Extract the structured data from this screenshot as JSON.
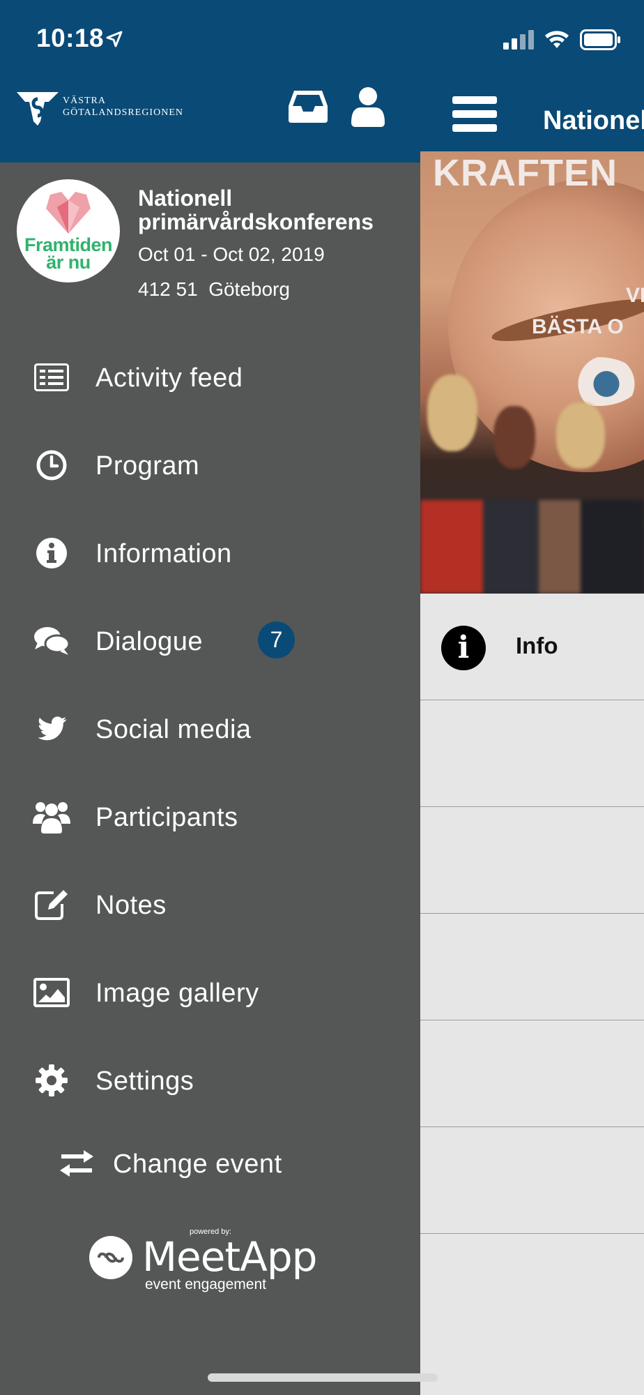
{
  "status_bar": {
    "time": "10:18"
  },
  "drawer": {
    "org_logo_text": "VÄSTRA\nGÖTALANDSREGIONEN",
    "event": {
      "logo_text": "Framtiden\när nu",
      "title": "Nationell primärvårdskonferens",
      "dates": "Oct 01 - Oct 02, 2019",
      "location": "412 51  Göteborg"
    },
    "menu": [
      {
        "label": "Activity feed",
        "icon": "activity-feed-icon"
      },
      {
        "label": "Program",
        "icon": "clock-icon"
      },
      {
        "label": "Information",
        "icon": "info-icon"
      },
      {
        "label": "Dialogue",
        "icon": "chat-bubbles-icon",
        "badge": "7"
      },
      {
        "label": "Social media",
        "icon": "twitter-icon"
      },
      {
        "label": "Participants",
        "icon": "participants-icon"
      },
      {
        "label": "Notes",
        "icon": "notes-icon"
      },
      {
        "label": "Image gallery",
        "icon": "image-icon"
      },
      {
        "label": "Settings",
        "icon": "gear-icon"
      }
    ],
    "change_event_label": "Change event",
    "powered_by": "powered by:",
    "meetapp_name": "MeetApp",
    "meetapp_tagline": "event engagement"
  },
  "main": {
    "title": "Nationell",
    "hero_text": {
      "line1": "KRAFTEN",
      "line2": "VI",
      "line3": "BÄSTA O"
    },
    "list": [
      {
        "label": "Info",
        "icon": "info-icon"
      }
    ]
  },
  "colors": {
    "header_blue": "#0a4a76",
    "drawer_gray": "#545756",
    "badge_blue": "#0a4a76",
    "content_bg": "#e6e6e6"
  }
}
